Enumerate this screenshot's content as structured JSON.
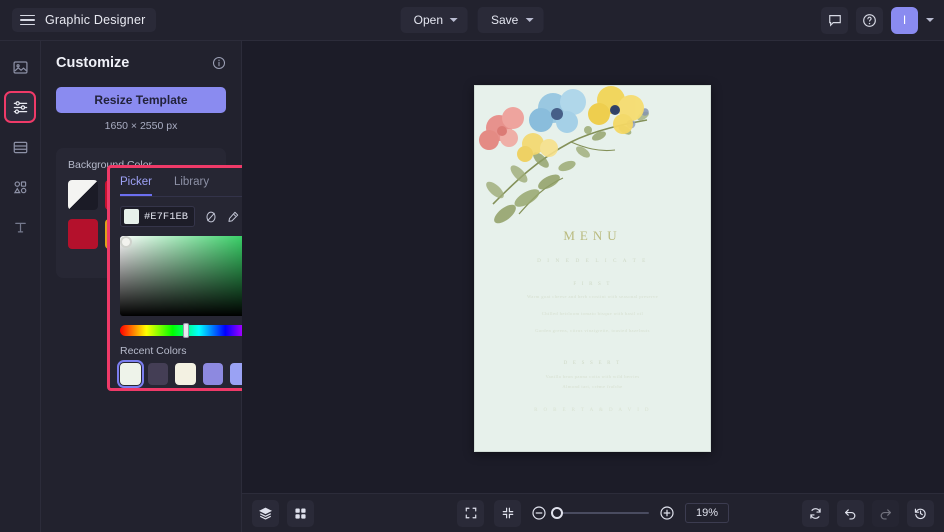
{
  "topbar": {
    "menu_icon": "hamburger-icon",
    "title": "Graphic Designer",
    "open_label": "Open",
    "save_label": "Save",
    "comment_icon": "comment-icon",
    "help_icon": "help-icon",
    "avatar_initial": "I"
  },
  "rail": {
    "items": [
      {
        "name": "image",
        "icon": "image-icon",
        "active": false
      },
      {
        "name": "customize",
        "icon": "sliders-icon",
        "active": true
      },
      {
        "name": "layout",
        "icon": "layout-icon",
        "active": false
      },
      {
        "name": "shapes",
        "icon": "shapes-icon",
        "active": false
      },
      {
        "name": "text",
        "icon": "text-icon",
        "active": false
      }
    ]
  },
  "panel": {
    "title": "Customize",
    "info_icon": "info-icon",
    "resize_label": "Resize Template",
    "dimensions": "1650 × 2550 px",
    "background_color_label": "Background Color",
    "swatches": [
      "#f4f4f2",
      "#c8112f",
      "#b4112c",
      "#e0a11b"
    ]
  },
  "picker": {
    "tabs": [
      {
        "label": "Picker",
        "active": true
      },
      {
        "label": "Library",
        "active": false
      }
    ],
    "hex_value": "#E7F1EB",
    "hex_swatch": "#e7f1eb",
    "tools": [
      "no-color-icon",
      "eyedropper-icon",
      "palette-grid-icon",
      "add-icon"
    ],
    "hue_position_pct": 40,
    "recent_colors_label": "Recent Colors",
    "recent_colors": [
      {
        "color": "#eef3ea",
        "selected": true
      },
      {
        "color": "#443e55",
        "selected": false
      },
      {
        "color": "#f3f1e2",
        "selected": false
      },
      {
        "color": "#8d89e0",
        "selected": false
      },
      {
        "color": "#9aa2f4",
        "selected": false
      },
      {
        "color": "#4a4bc4",
        "selected": false
      }
    ],
    "annotation_color": "#ef3a68"
  },
  "canvas": {
    "background": "#e7f1eb",
    "title": "MENU",
    "subtitle": "D I N E   D E L I C A T E",
    "sections": [
      {
        "heading": "F I R S T",
        "lines": [
          "Warm goat cheese and herb crostini with seasonal preserve",
          "Chilled heirloom tomato bisque with basil oil",
          "Garden greens, citrus vinaigrette, toasted hazelnuts"
        ]
      },
      {
        "heading": "D E S S E R T",
        "lines": [
          "Vanilla bean panna cotta with wild berries",
          "Almond tart, crème fraîche"
        ]
      }
    ],
    "footer": "R O B E R T A   &   D A V I D"
  },
  "bottombar": {
    "layers_icon": "layers-icon",
    "grid_icon": "grid-icon",
    "fullscreen_icon": "fullscreen-icon",
    "fit_icon": "fit-to-screen-icon",
    "zoom_out_icon": "zoom-out-icon",
    "zoom_in_icon": "zoom-in-icon",
    "zoom_level": "19%",
    "refresh_icon": "refresh-icon",
    "undo_icon": "undo-icon",
    "redo_icon": "redo-icon",
    "history_icon": "history-icon"
  }
}
